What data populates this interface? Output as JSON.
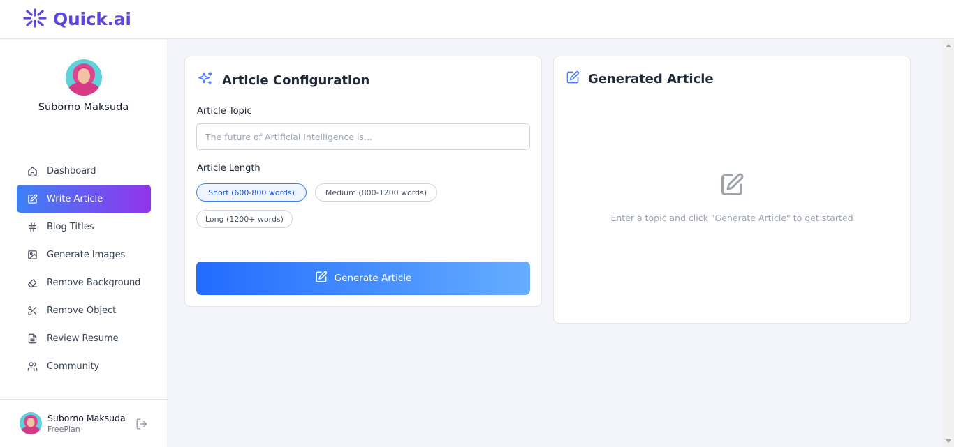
{
  "app": {
    "logo_text": "Quick.ai",
    "brand_color": "#5b46e0"
  },
  "sidebar": {
    "profile_name": "Suborno Maksuda",
    "items": [
      {
        "label": "Dashboard",
        "icon": "home-icon",
        "active": false
      },
      {
        "label": "Write Article",
        "icon": "edit-icon",
        "active": true
      },
      {
        "label": "Blog Titles",
        "icon": "hash-icon",
        "active": false
      },
      {
        "label": "Generate Images",
        "icon": "image-icon",
        "active": false
      },
      {
        "label": "Remove Background",
        "icon": "eraser-icon",
        "active": false
      },
      {
        "label": "Remove Object",
        "icon": "scissors-icon",
        "active": false
      },
      {
        "label": "Review Resume",
        "icon": "file-text-icon",
        "active": false
      },
      {
        "label": "Community",
        "icon": "users-icon",
        "active": false
      }
    ],
    "active_gradient": [
      "#3c81f6",
      "#9234ea"
    ],
    "footer": {
      "name": "Suborno Maksuda",
      "plan": "FreePlan"
    }
  },
  "config": {
    "title": "Article Configuration",
    "topic_label": "Article Topic",
    "topic_value": "",
    "topic_placeholder": "The future of Artificial Intelligence is...",
    "length_label": "Article Length",
    "length_options": [
      {
        "label": "Short (600-800 words)",
        "selected": true
      },
      {
        "label": "Medium (800-1200 words)",
        "selected": false
      },
      {
        "label": "Long (1200+ words)",
        "selected": false
      }
    ],
    "generate_label": "Generate Article"
  },
  "result": {
    "title": "Generated Article",
    "empty_text": "Enter a topic and click \"Generate Article\" to get started"
  }
}
